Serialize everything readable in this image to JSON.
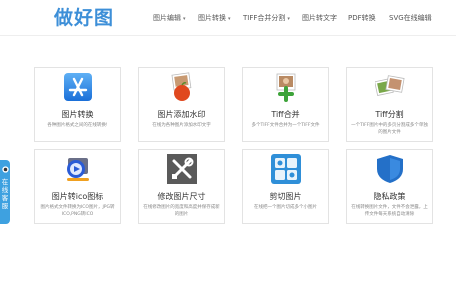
{
  "header": {
    "logo": "做好图",
    "nav": [
      {
        "label": "图片编辑",
        "has_caret": true
      },
      {
        "label": "图片转换",
        "has_caret": true
      },
      {
        "label": "TIFF合并分割",
        "has_caret": true
      },
      {
        "label": "图片转文字",
        "has_caret": false
      },
      {
        "label": "PDF转换",
        "has_caret": false
      },
      {
        "label": "SVG在线编辑",
        "has_caret": false
      }
    ]
  },
  "cards": [
    {
      "title": "图片转换",
      "desc": "各种图片格式之间的在线转换!",
      "icon": "app-store-icon"
    },
    {
      "title": "图片添加水印",
      "desc": "在线为各种图片添加水印文字",
      "icon": "photo-apple-icon"
    },
    {
      "title": "Tiff合并",
      "desc": "多个TIFF文件合并为一个TIFF文件",
      "icon": "photo-add-icon"
    },
    {
      "title": "Tiff分割",
      "desc": "一个TIFF图片中的多页分割成多个单独的图片文件",
      "icon": "photo-split-icon"
    },
    {
      "title": "图片转ico图标",
      "desc": "图片格式文件转换为ICO图片，JPG转ICO,PNG转ICO",
      "icon": "media-player-icon"
    },
    {
      "title": "修改图片尺寸",
      "desc": "在线修改图片的宽度和高度并保存成新的图片",
      "icon": "tools-icon"
    },
    {
      "title": "剪切图片",
      "desc": "在线把一个图片切成多个小图片",
      "icon": "grid-tiles-icon"
    },
    {
      "title": "隐私政策",
      "desc": "在线转换图片文件，文件不会泄露，上传文件每天系统自动清除",
      "icon": "shield-icon"
    }
  ],
  "float_tab": {
    "label": "在线客服"
  },
  "colors": {
    "accent": "#3d8fd8",
    "tab": "#3ea1e0"
  }
}
